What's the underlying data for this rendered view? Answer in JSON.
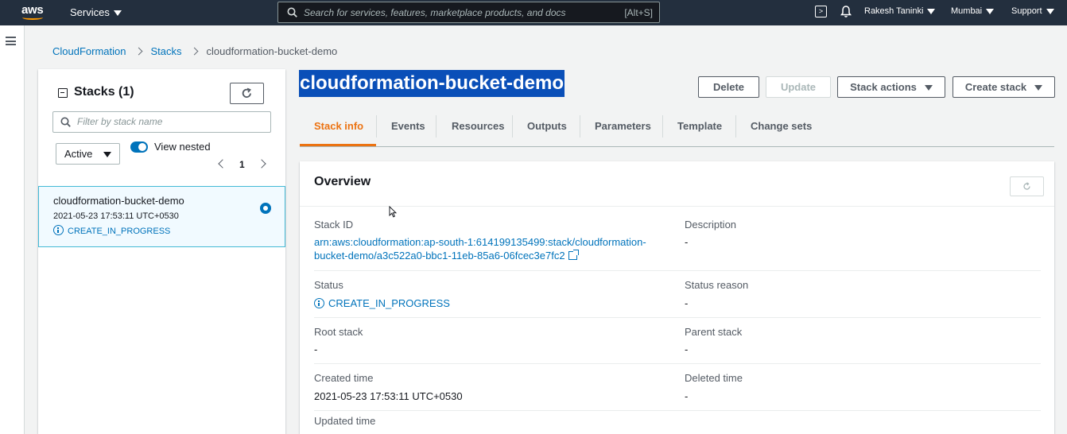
{
  "topnav": {
    "logo": "aws",
    "services_label": "Services",
    "search_placeholder": "Search for services, features, marketplace products, and docs",
    "search_shortcut": "[Alt+S]",
    "user": "Rakesh Taninki",
    "region": "Mumbai",
    "support": "Support",
    "icons": [
      "cloudshell-icon",
      "bell-icon"
    ]
  },
  "breadcrumb": {
    "items": [
      "CloudFormation",
      "Stacks"
    ],
    "current": "cloudformation-bucket-demo"
  },
  "stacks_panel": {
    "title": "Stacks (1)",
    "filter_placeholder": "Filter by stack name",
    "filter_select": "Active",
    "view_nested_label": "View nested",
    "view_nested_on": true,
    "page": "1",
    "stacks": [
      {
        "name": "cloudformation-bucket-demo",
        "created": "2021-05-23 17:53:11 UTC+0530",
        "status": "CREATE_IN_PROGRESS",
        "selected": true
      }
    ]
  },
  "main": {
    "title": "cloudformation-bucket-demo",
    "buttons": {
      "delete": "Delete",
      "update": "Update",
      "stack_actions": "Stack actions",
      "create_stack": "Create stack"
    },
    "tabs": [
      "Stack info",
      "Events",
      "Resources",
      "Outputs",
      "Parameters",
      "Template",
      "Change sets"
    ],
    "active_tab": "Stack info"
  },
  "overview": {
    "title": "Overview",
    "stack_id_label": "Stack ID",
    "stack_id_line1": "arn:aws:cloudformation:ap-south-1:614199135499:stack/cloudformation-",
    "stack_id_line2": "bucket-demo/a3c522a0-bbc1-11eb-85a6-06fcec3e7fc2",
    "description_label": "Description",
    "description": "-",
    "status_label": "Status",
    "status": "CREATE_IN_PROGRESS",
    "status_reason_label": "Status reason",
    "status_reason": "-",
    "root_stack_label": "Root stack",
    "root_stack": "-",
    "parent_stack_label": "Parent stack",
    "parent_stack": "-",
    "created_time_label": "Created time",
    "created_time": "2021-05-23 17:53:11 UTC+0530",
    "deleted_time_label": "Deleted time",
    "deleted_time": "-",
    "updated_time_label": "Updated time"
  },
  "colors": {
    "nav_bg": "#232f3e",
    "link": "#0073bb",
    "active_tab": "#ec7211",
    "title_highlight": "#0a4fb8"
  }
}
